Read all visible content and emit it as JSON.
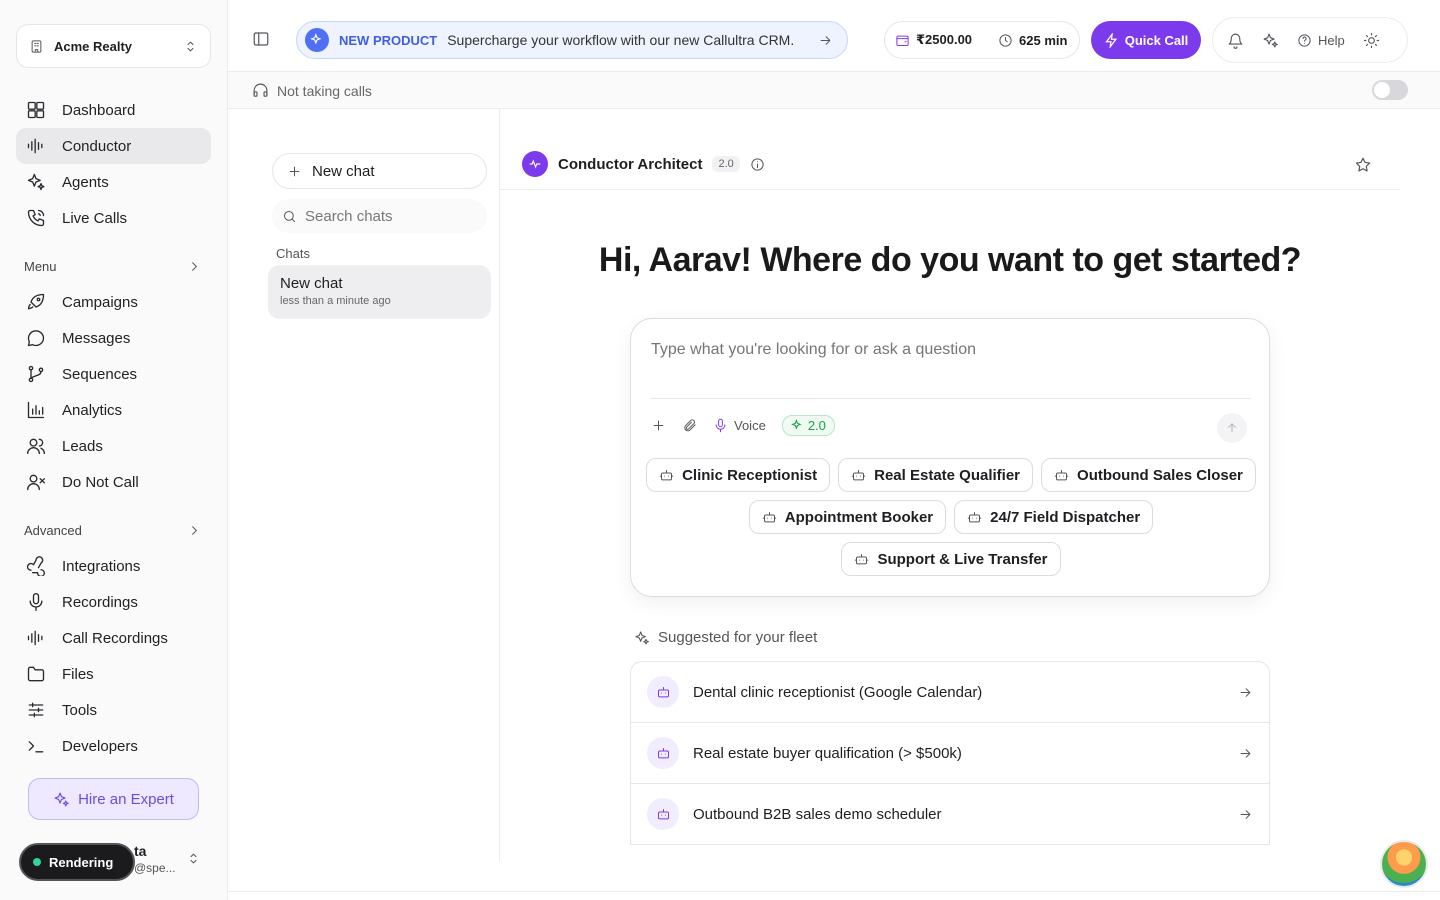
{
  "org": {
    "name": "Acme Realty"
  },
  "nav": {
    "primary": [
      {
        "label": "Dashboard",
        "icon": "dashboard-icon"
      },
      {
        "label": "Conductor",
        "icon": "waveform-icon"
      },
      {
        "label": "Agents",
        "icon": "sparkles-icon"
      },
      {
        "label": "Live Calls",
        "icon": "phone-icon"
      }
    ],
    "menu_label": "Menu",
    "menu": [
      {
        "label": "Campaigns",
        "icon": "rocket-icon"
      },
      {
        "label": "Messages",
        "icon": "message-icon"
      },
      {
        "label": "Sequences",
        "icon": "branch-icon"
      },
      {
        "label": "Analytics",
        "icon": "bar-chart-icon"
      },
      {
        "label": "Leads",
        "icon": "users-icon"
      },
      {
        "label": "Do Not Call",
        "icon": "user-x-icon"
      }
    ],
    "advanced_label": "Advanced",
    "advanced": [
      {
        "label": "Integrations",
        "icon": "webhook-icon"
      },
      {
        "label": "Recordings",
        "icon": "mic-icon"
      },
      {
        "label": "Call Recordings",
        "icon": "audio-lines-icon"
      },
      {
        "label": "Files",
        "icon": "folder-icon"
      },
      {
        "label": "Tools",
        "icon": "sliders-icon"
      },
      {
        "label": "Developers",
        "icon": "terminal-icon"
      }
    ],
    "hire": "Hire an Expert"
  },
  "user": {
    "name_visible": "ta",
    "email_visible": "@spe...",
    "rendering_label": "Rendering"
  },
  "topbar": {
    "promo_tag": "NEW PRODUCT",
    "promo_text": "Supercharge your workflow with our new Callultra CRM.",
    "balance": "₹2500.00",
    "minutes": "625 min",
    "quick_call": "Quick Call",
    "help": "Help"
  },
  "status": {
    "text": "Not taking calls",
    "receiving_calls": false
  },
  "chats": {
    "new_chat": "New chat",
    "search_placeholder": "Search chats",
    "section": "Chats",
    "items": [
      {
        "title": "New chat",
        "time": "less than a minute ago"
      }
    ]
  },
  "main": {
    "agent_name": "Conductor Architect",
    "agent_version": "2.0",
    "greeting": "Hi, Aarav! Where do you want to get started?",
    "composer_placeholder": "Type what you're looking for or ask a question",
    "voice": "Voice",
    "model_badge": "2.0",
    "chips_row1": [
      "Clinic Receptionist",
      "Real Estate Qualifier",
      "Outbound Sales Closer"
    ],
    "chips_row2": [
      "Appointment Booker",
      "24/7 Field Dispatcher"
    ],
    "chips_row3": [
      "Support & Live Transfer"
    ],
    "suggest_title": "Suggested for your fleet",
    "suggestions": [
      "Dental clinic receptionist (Google Calendar)",
      "Real estate buyer qualification (> $500k)",
      "Outbound B2B sales demo scheduler"
    ]
  },
  "colors": {
    "accent": "#7c3aed",
    "promo": "#4f6ff5",
    "success": "#16a34a"
  }
}
